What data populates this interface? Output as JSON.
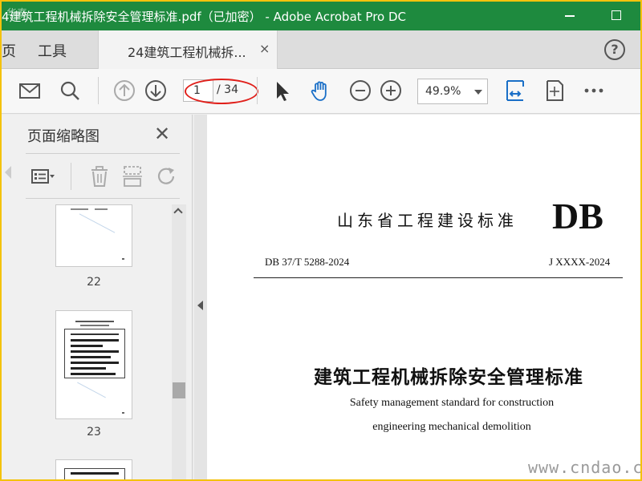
{
  "window": {
    "title": "4建筑工程机械拆除安全管理标准.pdf（已加密） - Adobe Acrobat Pro DC",
    "corner_watermark": "华泰"
  },
  "tabs": {
    "home": "页",
    "tools": "工具",
    "document": "24建筑工程机械拆...",
    "close_glyph": "×",
    "help_glyph": "?"
  },
  "toolbar": {
    "current_page": "1",
    "total_pages": "/ 34",
    "zoom": "49.9%"
  },
  "sidebar": {
    "title": "页面缩略图",
    "close_glyph": "✕",
    "thumbnails": [
      {
        "label": "22"
      },
      {
        "label": "23"
      }
    ]
  },
  "document": {
    "header": "山东省工程建设标准",
    "db": "DB",
    "code": "DB 37/T 5288-2024",
    "jcode": "J XXXX-2024",
    "title": "建筑工程机械拆除安全管理标准",
    "subtitle_line1": "Safety management standard for construction",
    "subtitle_line2": "engineering mechanical demolition"
  },
  "site_watermark": "www.cndao.com",
  "colors": {
    "titlebar": "#1e8a3e",
    "border": "#f4c20d",
    "annotation": "#e0201b",
    "accent_icon": "#1a6fc7"
  }
}
